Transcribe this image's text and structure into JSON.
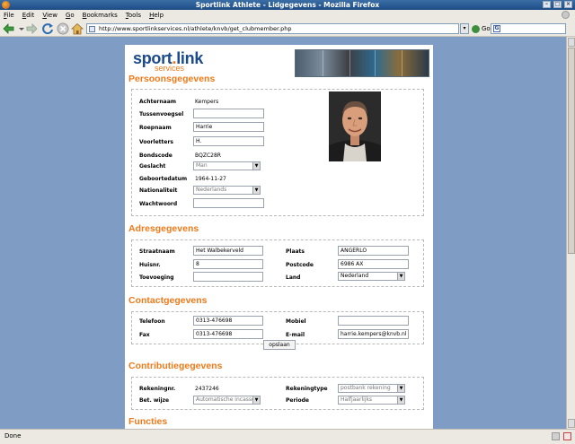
{
  "window": {
    "title": "Sportlink Athlete - Lidgegevens - Mozilla Firefox"
  },
  "menu": [
    "File",
    "Edit",
    "View",
    "Go",
    "Bookmarks",
    "Tools",
    "Help"
  ],
  "nav": {
    "url": "http://www.sportlinkservices.nl/athlete/knvb/get_clubmember.php",
    "go_label": "Go"
  },
  "status": "Done",
  "logo": {
    "main": "sport",
    "dot": ".",
    "tail": "link",
    "sub": "services"
  },
  "sections": {
    "persoonsgegevens": "Persoonsgegevens",
    "adresgegevens": "Adresgegevens",
    "contactgegevens": "Contactgegevens",
    "contributie": "Contributiegegevens",
    "functies": "Functies"
  },
  "persoon": {
    "achternaam_label": "Achternaam",
    "achternaam": "Kempers",
    "tussenvoegsel_label": "Tussenvoegsel",
    "tussenvoegsel": "",
    "roepnaam_label": "Roepnaam",
    "roepnaam": "Harrie",
    "voorletters_label": "Voorletters",
    "voorletters": "H.",
    "bondscode_label": "Bondscode",
    "bondscode": "BQZC28R",
    "geslacht_label": "Geslacht",
    "geslacht": "Man",
    "geboortedatum_label": "Geboortedatum",
    "geboortedatum": "1964-11-27",
    "nationaliteit_label": "Nationaliteit",
    "nationaliteit": "Nederlands",
    "wachtwoord_label": "Wachtwoord",
    "wachtwoord": ""
  },
  "adres": {
    "straatnaam_label": "Straatnaam",
    "straatnaam": "Het Walbekerveld",
    "huisnr_label": "Huisnr.",
    "huisnr": "8",
    "toevoeging_label": "Toevoeging",
    "toevoeging": "",
    "plaats_label": "Plaats",
    "plaats": "ANGERLO",
    "postcode_label": "Postcode",
    "postcode": "6986 AX",
    "land_label": "Land",
    "land": "Nederland"
  },
  "contact": {
    "telefoon_label": "Telefoon",
    "telefoon": "0313-476698",
    "fax_label": "Fax",
    "fax": "0313-476698",
    "mobiel_label": "Mobiel",
    "mobiel": "",
    "email_label": "E-mail",
    "email": "harrie.kempers@knvb.nl"
  },
  "opslaan": "opslaan",
  "contributie": {
    "rekeningnr_label": "Rekeningnr.",
    "rekeningnr": "2437246",
    "betwijze_label": "Bet. wijze",
    "betwijze": "Automatische incasso",
    "rekeningtype_label": "Rekeningtype",
    "rekeningtype": "postbank rekening",
    "periode_label": "Periode",
    "periode": "Halfjaarlijks"
  }
}
